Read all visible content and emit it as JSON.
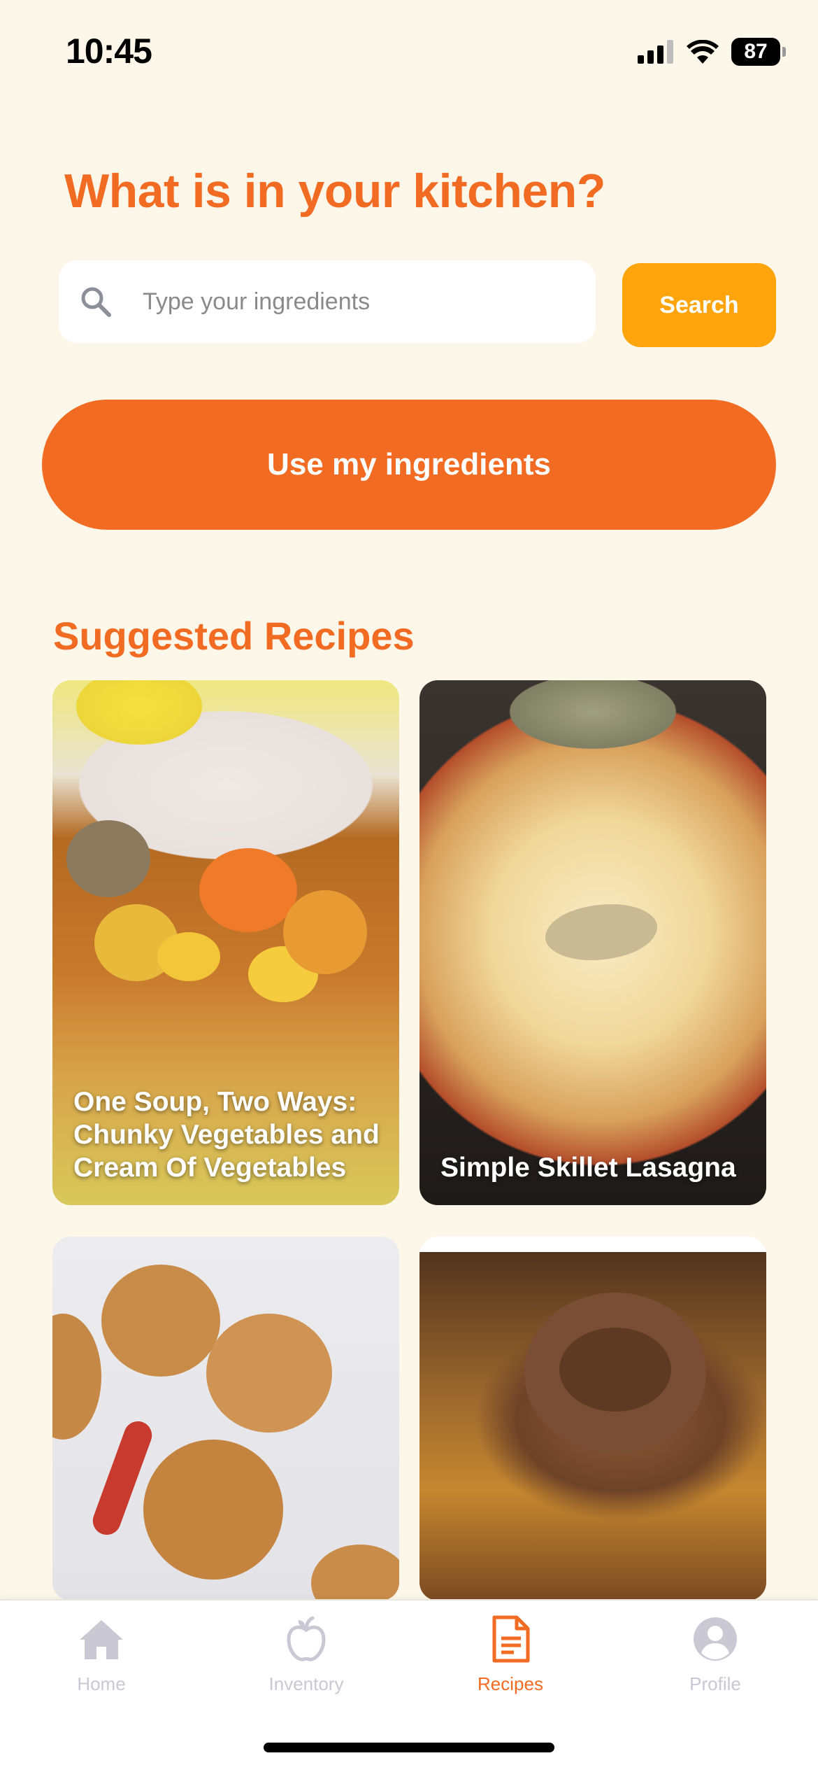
{
  "status_bar": {
    "time": "10:45",
    "battery": "87",
    "icons": [
      "cellular-signal-icon",
      "wifi-icon",
      "battery-icon"
    ]
  },
  "headline": "What is in your kitchen?",
  "search": {
    "placeholder": "Type your ingredients",
    "value": "",
    "button_label": "Search"
  },
  "use_ingredients_label": "Use my ingredients",
  "suggested": {
    "title": "Suggested Recipes",
    "recipes": [
      {
        "title": "One Soup, Two Ways: Chunky Vegetables and Cream Of Vegetables"
      },
      {
        "title": "Simple Skillet Lasagna"
      },
      {
        "title": ""
      },
      {
        "title": ""
      }
    ]
  },
  "tabs": [
    {
      "label": "Home",
      "icon": "home-icon",
      "active": false
    },
    {
      "label": "Inventory",
      "icon": "apple-icon",
      "active": false
    },
    {
      "label": "Recipes",
      "icon": "document-icon",
      "active": true
    },
    {
      "label": "Profile",
      "icon": "user-icon",
      "active": false
    }
  ],
  "colors": {
    "background": "#FDF7EA",
    "primary": "#F26B22",
    "search_button": "#FFA40A",
    "tab_inactive": "#C9C8D3"
  }
}
